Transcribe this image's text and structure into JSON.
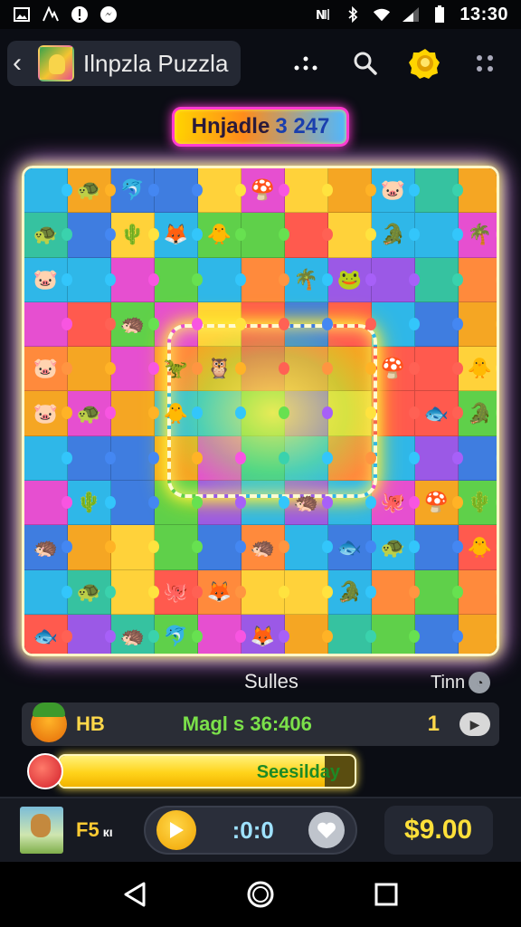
{
  "status_bar": {
    "time": "13:30"
  },
  "header": {
    "title": "Ilnpzla Puzzla"
  },
  "level": {
    "label": "Hnjadle",
    "number": "3 247"
  },
  "board": {
    "rows": 11,
    "cols": 11,
    "palette": [
      "#ff5a4e",
      "#f5a623",
      "#ffd23a",
      "#5fd04a",
      "#2fb7e8",
      "#3f7de0",
      "#e64fd0",
      "#9b59e6",
      "#ff8a3c",
      "#36c2a0"
    ],
    "art": [
      "🐷",
      "🦉",
      "🐟",
      "🌴",
      "🐸",
      "🦔",
      "🐢",
      "🍄",
      "🦊",
      "🐊",
      "🐙",
      "🐥",
      "🦖",
      "🐬",
      "🌵"
    ]
  },
  "info": {
    "center_label": "Sulles",
    "time_label": "Tinn"
  },
  "stats": {
    "left_label": "HB",
    "middle_label": "Magl s 36:406",
    "count": "1"
  },
  "progress": {
    "text": "Seesilday",
    "fraction": 0.9
  },
  "bottom": {
    "player_name": "F5",
    "player_suffix": "кı",
    "timer": ":0:0",
    "price": "$9.00"
  },
  "colors": {
    "accent_yellow": "#ffd84a",
    "accent_pink": "#ff3ad0",
    "accent_green": "#7be04a"
  }
}
